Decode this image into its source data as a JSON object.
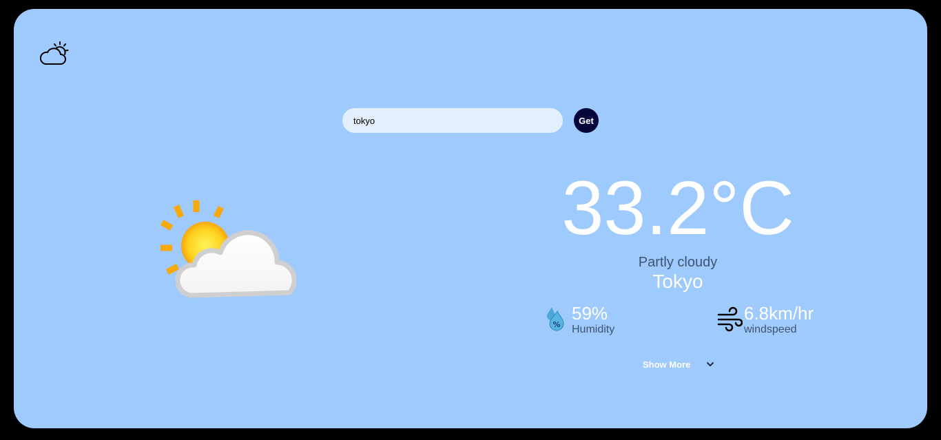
{
  "search": {
    "value": "tokyo",
    "button_label": "Get"
  },
  "weather": {
    "temperature": "33.2°C",
    "condition": "Partly cloudy",
    "city": "Tokyo",
    "icon": "partly-cloudy-icon",
    "humidity": {
      "value": "59%",
      "label": "Humidity",
      "icon": "humidity-icon"
    },
    "windspeed": {
      "value": "6.8km/hr",
      "label": "windspeed",
      "icon": "wind-icon"
    }
  },
  "footer": {
    "show_more_label": "Show More"
  },
  "colors": {
    "page_background": "#000000",
    "card_background": "#9ecafe",
    "search_background": "#e3effc",
    "button_background": "#06063a",
    "muted_text": "#3f5470"
  }
}
